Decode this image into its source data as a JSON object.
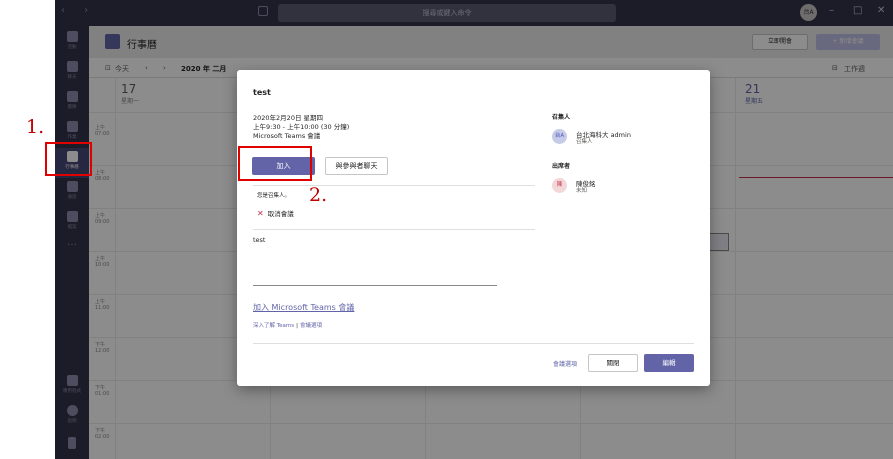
{
  "titlebar": {
    "nav_arrows": "‹ ›",
    "search_placeholder": "搜尋或鍵入命令",
    "user_initials": "台A",
    "minimize": "–",
    "restore": "□",
    "close": "✕"
  },
  "rail": {
    "items": [
      {
        "label": "活動"
      },
      {
        "label": "聊天"
      },
      {
        "label": "團隊"
      },
      {
        "label": "作業"
      },
      {
        "label": "行事曆"
      },
      {
        "label": "通話"
      },
      {
        "label": "檔案"
      }
    ],
    "more": "···",
    "apps_label": "應用程式",
    "help_label": "說明"
  },
  "calendar": {
    "title": "行事曆",
    "meet_now": "立即開會",
    "new_meeting": "+ 新增會議",
    "today": "今天",
    "month": "2020 年 二月",
    "workweek": "工作週",
    "days": [
      {
        "num": "17",
        "weekday": "星期一"
      },
      {
        "num": "21",
        "weekday": "星期五"
      }
    ],
    "times": [
      {
        "ampm": "上午",
        "hm": "07:00"
      },
      {
        "ampm": "上午",
        "hm": "08:00"
      },
      {
        "ampm": "上午",
        "hm": "09:00"
      },
      {
        "ampm": "上午",
        "hm": "10:00"
      },
      {
        "ampm": "上午",
        "hm": "11:00"
      },
      {
        "ampm": "下午",
        "hm": "12:00"
      },
      {
        "ampm": "下午",
        "hm": "01:00"
      },
      {
        "ampm": "下午",
        "hm": "02:00"
      }
    ]
  },
  "dialog": {
    "title": "test",
    "date_line": "2020年2月20日 星期四",
    "time_line": "上午9:30 - 上午10:00 (30 分鐘)",
    "location": "Microsoft Teams 會議",
    "join_button": "加入",
    "chat_button": "與參與者聊天",
    "organizer_note": "您是召集人。",
    "cancel_meeting": "取消會議",
    "description": "test",
    "join_link": "加入 Microsoft Teams 會議",
    "learn_more": "深入了解 Teams",
    "meeting_options_link": "會議選項",
    "organizer_heading": "召集人",
    "organizer_initials": "台A",
    "organizer_name": "台北海科大 admin",
    "organizer_role": "召集人",
    "attendees_heading": "出席者",
    "attendee_initials": "陳",
    "attendee_name": "陳俊銘",
    "attendee_status": "未知",
    "footer_options": "會議選項",
    "close_button": "關閉",
    "edit_button": "編輯"
  },
  "annotations": {
    "step1": "1.",
    "step2": "2."
  },
  "colors": {
    "accent": "#6264a7",
    "titlebar": "#33344a",
    "highlight": "#e00000"
  }
}
